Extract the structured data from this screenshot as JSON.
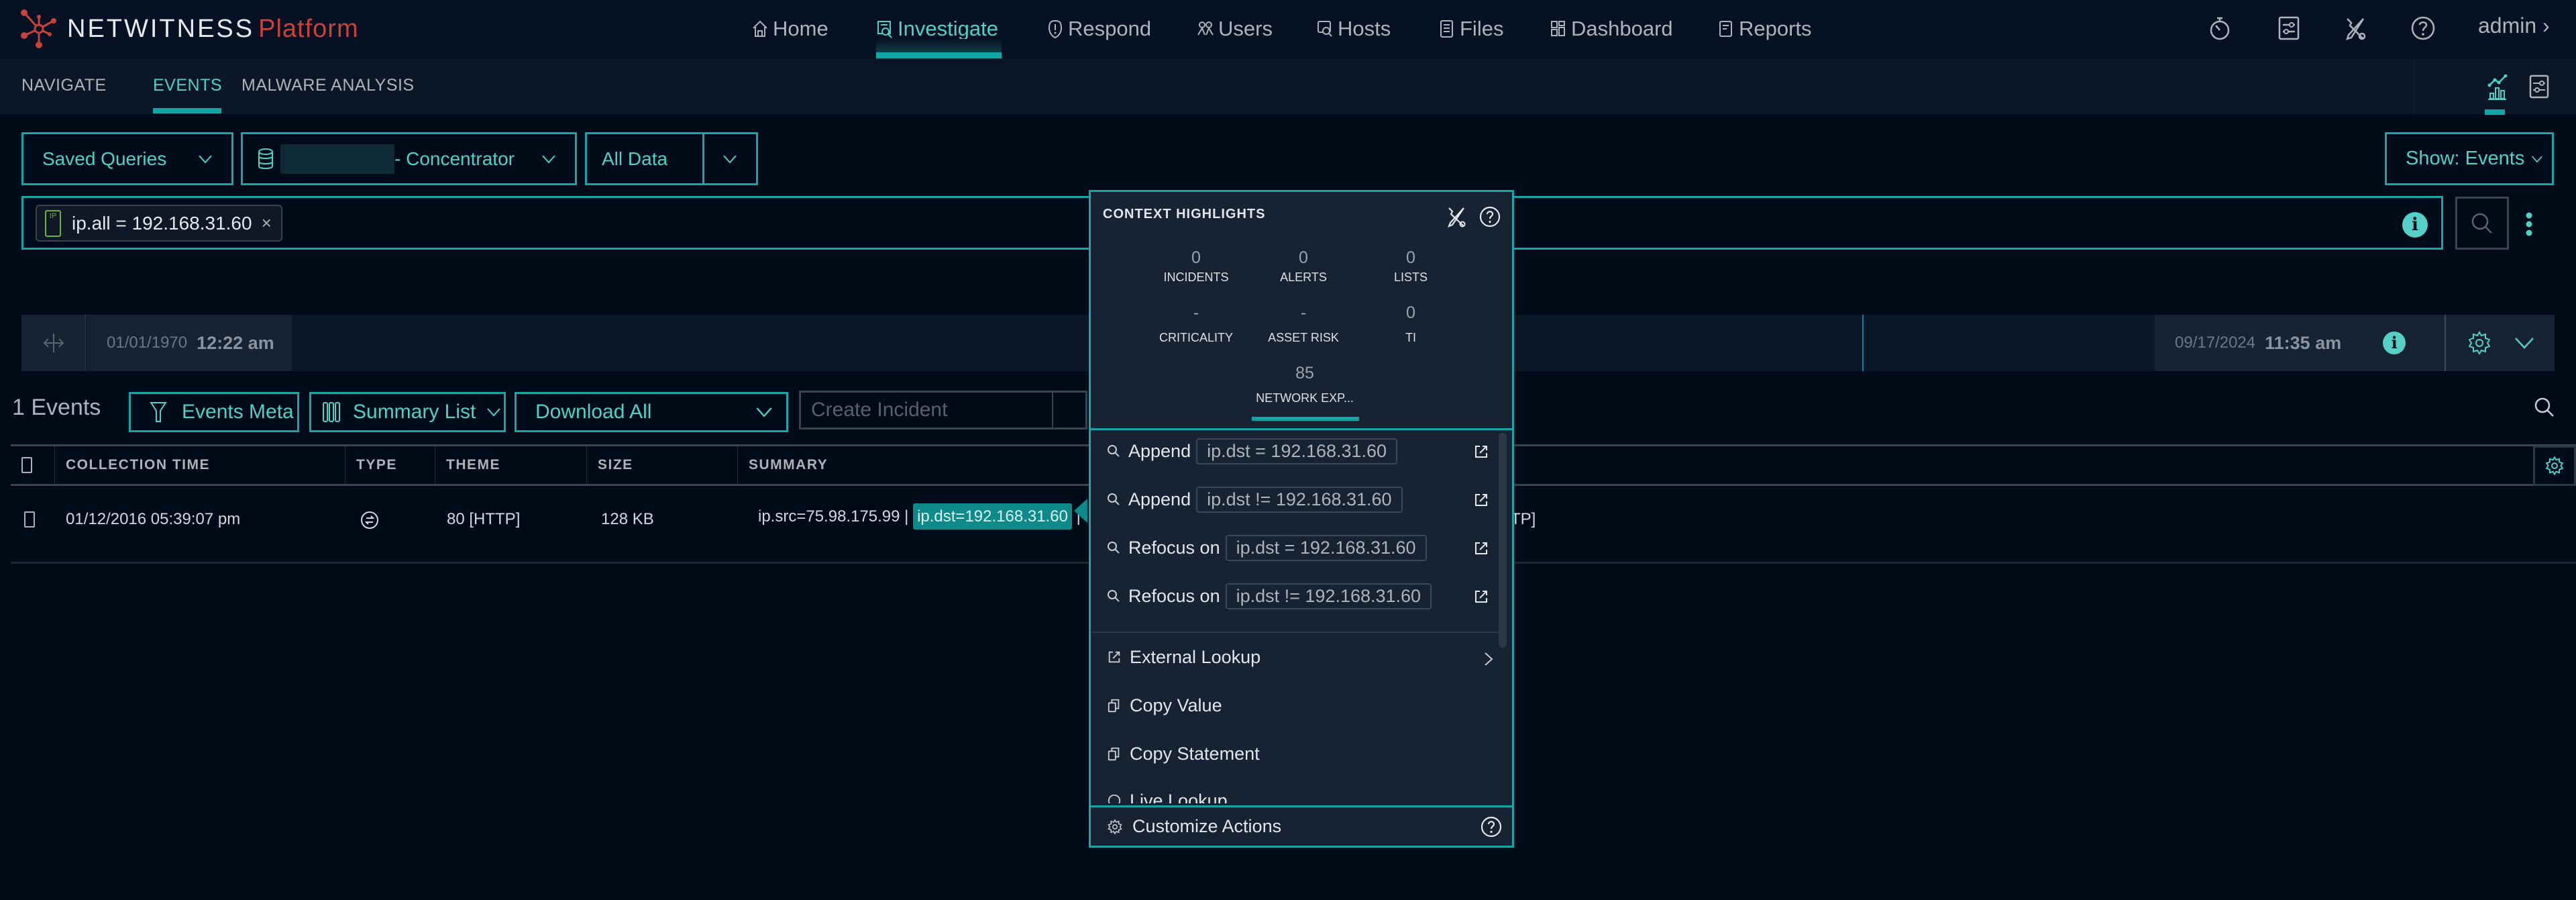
{
  "app": {
    "logo_word": "NETWITNESS",
    "logo_product": "Platform",
    "user": "admin"
  },
  "colors": {
    "accent": "#17a5a5",
    "accent_text": "#4fd1c5",
    "logo_red": "#c8423b",
    "background": "#000b1a"
  },
  "topnav": {
    "items": [
      {
        "label": "Home",
        "icon": "home-icon",
        "active": false
      },
      {
        "label": "Investigate",
        "icon": "investigate-icon",
        "active": true
      },
      {
        "label": "Respond",
        "icon": "shield-alert-icon",
        "active": false
      },
      {
        "label": "Users",
        "icon": "users-icon",
        "active": false
      },
      {
        "label": "Hosts",
        "icon": "hosts-icon",
        "active": false
      },
      {
        "label": "Files",
        "icon": "file-icon",
        "active": false
      },
      {
        "label": "Dashboard",
        "icon": "dashboard-icon",
        "active": false
      },
      {
        "label": "Reports",
        "icon": "report-icon",
        "active": false
      }
    ],
    "right_icons": [
      "stopwatch-icon",
      "settings-sliders-icon",
      "tools-icon",
      "help-icon"
    ]
  },
  "subnav": {
    "items": [
      {
        "label": "NAVIGATE",
        "active": false
      },
      {
        "label": "EVENTS",
        "active": true
      },
      {
        "label": "MALWARE ANALYSIS",
        "active": false
      }
    ],
    "right_icons": [
      "chart-icon",
      "settings-sliders-icon"
    ]
  },
  "query": {
    "saved_queries_label": "Saved Queries",
    "service_label": "- Concentrator",
    "time_range_label": "All Data",
    "show_label": "Show: Events",
    "pill_text": "ip.all = 192.168.31.60",
    "pill_icon_text": "IP"
  },
  "timeline": {
    "start_date": "01/01/1970",
    "start_time": "12:22 am",
    "end_date": "09/17/2024",
    "end_time": "11:35 am"
  },
  "events_toolbar": {
    "count_label": "1 Events",
    "events_meta_label": "Events Meta",
    "summary_list_label": "Summary List",
    "download_label": "Download All",
    "create_incident_label": "Create Incident"
  },
  "table": {
    "columns": [
      "COLLECTION TIME",
      "TYPE",
      "THEME",
      "SIZE",
      "SUMMARY"
    ],
    "rows": [
      {
        "collection_time": "01/12/2016 05:39:07 pm",
        "type_icon": "network-icon",
        "theme": "80 [HTTP]",
        "size": "128 KB",
        "summary_prefix": "ip.src=75.98.175.99 |",
        "summary_highlight": "ip.dst=192.168.31.60",
        "summary_suffix_sep": "|",
        "summary_trailing": "TP]"
      }
    ]
  },
  "context_popup": {
    "title": "CONTEXT HIGHLIGHTS",
    "stats": [
      {
        "value": "0",
        "label": "INCIDENTS"
      },
      {
        "value": "0",
        "label": "ALERTS"
      },
      {
        "value": "0",
        "label": "LISTS"
      },
      {
        "value": "-",
        "label": "CRITICALITY"
      },
      {
        "value": "-",
        "label": "ASSET RISK"
      },
      {
        "value": "0",
        "label": "TI"
      },
      {
        "value": "85",
        "label": "NETWORK EXP..."
      }
    ],
    "actions": [
      {
        "verb": "Append",
        "statement": "ip.dst = 192.168.31.60"
      },
      {
        "verb": "Append",
        "statement": "ip.dst != 192.168.31.60"
      },
      {
        "verb": "Refocus on",
        "statement": "ip.dst = 192.168.31.60"
      },
      {
        "verb": "Refocus on",
        "statement": "ip.dst != 192.168.31.60"
      }
    ],
    "menu": [
      {
        "label": "External Lookup",
        "icon": "external-link-icon",
        "has_submenu": true
      },
      {
        "label": "Copy Value",
        "icon": "copy-icon",
        "has_submenu": false
      },
      {
        "label": "Copy Statement",
        "icon": "copy-icon",
        "has_submenu": false
      },
      {
        "label": "Live Lookup",
        "icon": "live-icon",
        "has_submenu": false
      }
    ],
    "customize_label": "Customize Actions"
  }
}
